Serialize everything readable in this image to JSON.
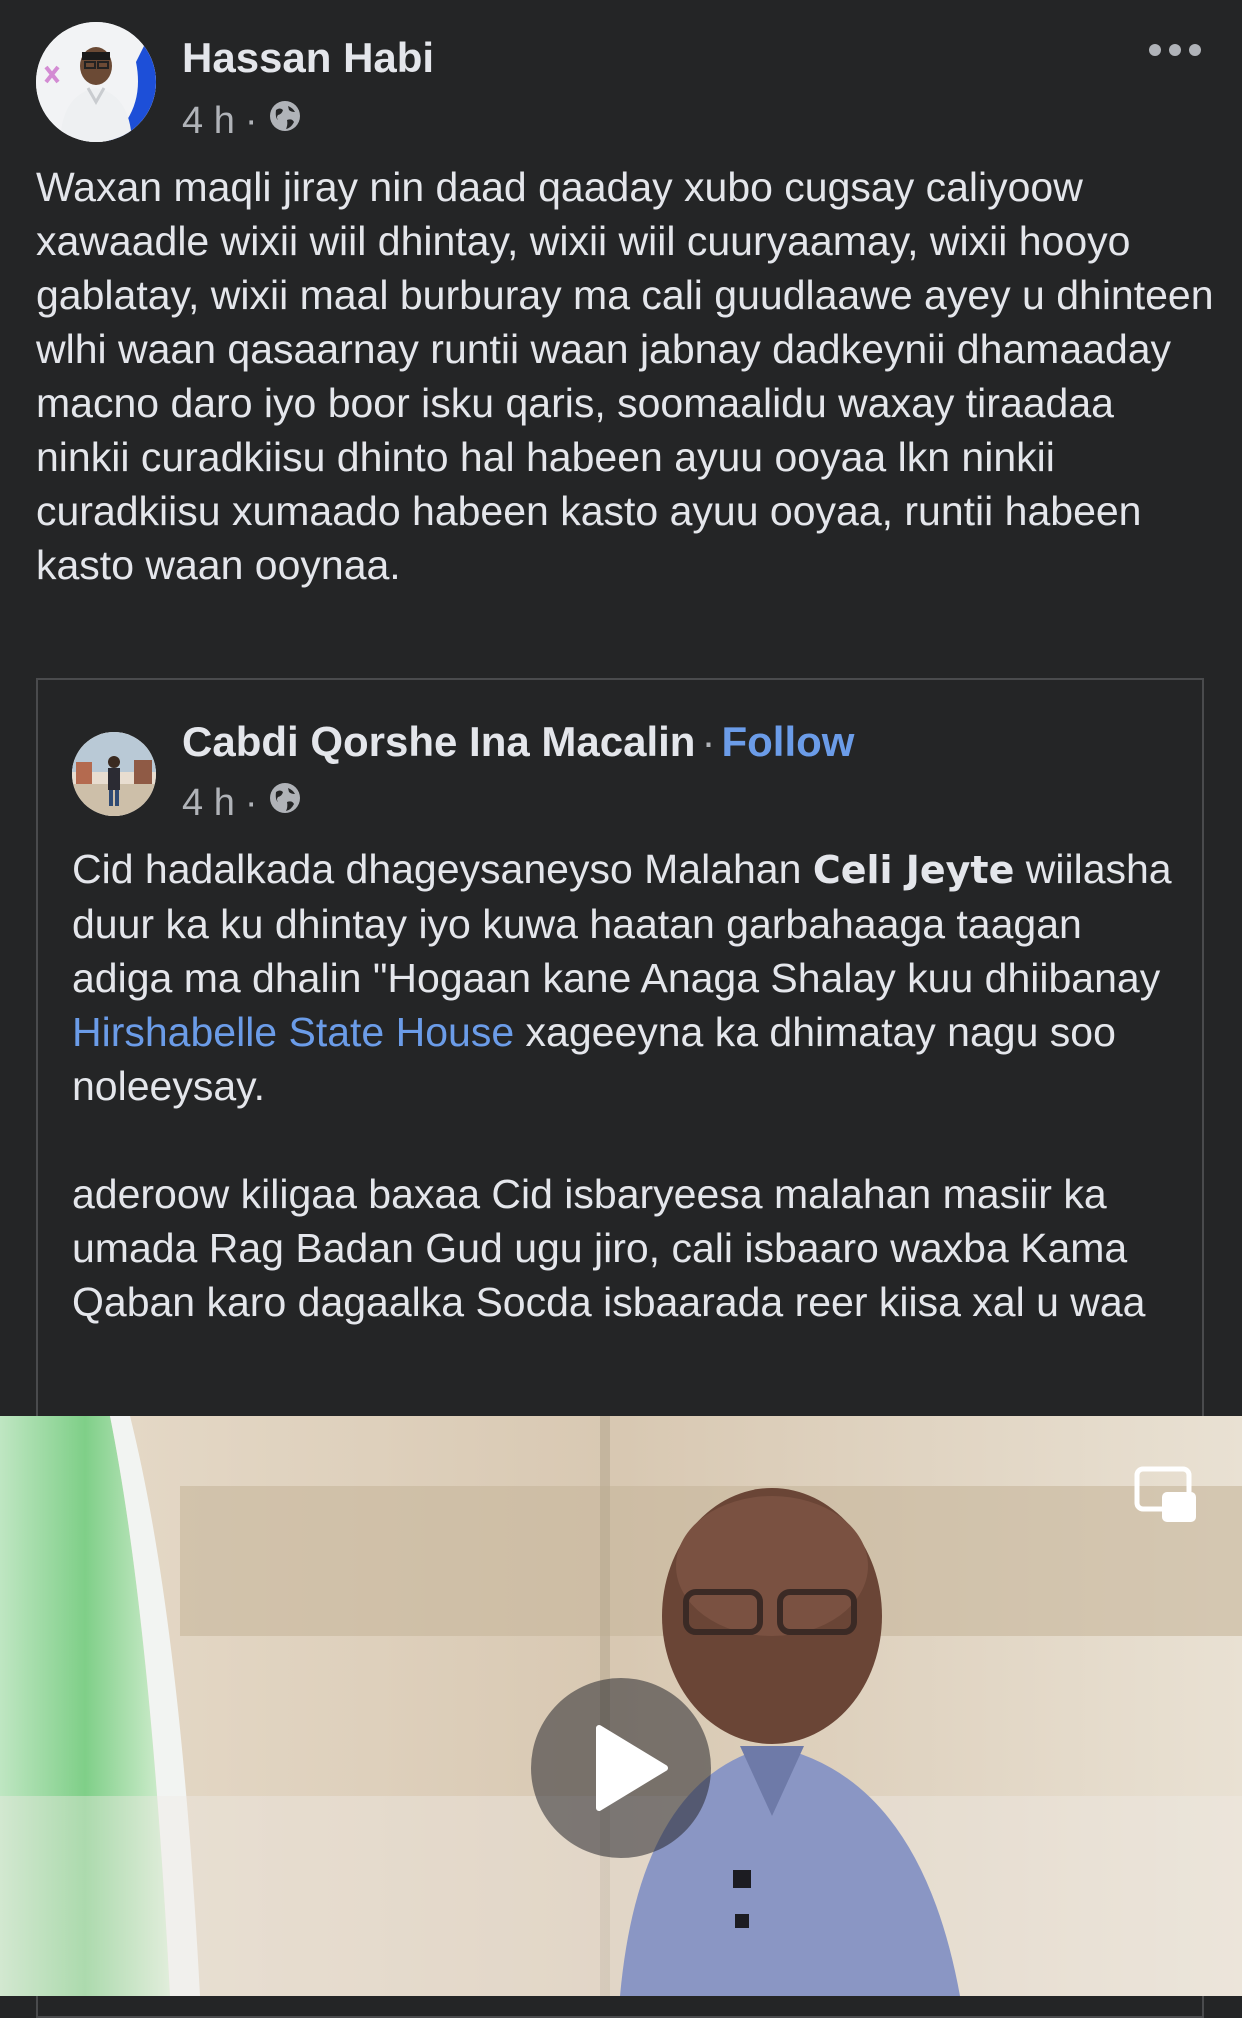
{
  "post": {
    "author": "Hassan Habi",
    "time": "4 h",
    "separator": "·",
    "audience_icon": "globe-icon",
    "more_icon": "more-horizontal-icon",
    "text": "Waxan maqli jiray nin daad qaaday xubo cugsay caliyoow xawaadle wixii wiil dhintay, wixii wiil cuuryaamay, wixii hooyo gablatay, wixii maal burburay ma cali guudlaawe ayey u dhinteen wlhi waan qasaarnay runtii waan jabnay dadkeynii dhamaaday macno daro iyo boor isku qaris, soomaalidu waxay tiraadaa ninkii curadkiisu dhinto hal habeen ayuu ooyaa lkn ninkii curadkiisu xumaado habeen kasto ayuu ooyaa, runtii habeen kasto waan ooynaa."
  },
  "shared_post": {
    "author": "Cabdi Qorshe Ina Macalin",
    "separator": "·",
    "follow_label": "Follow",
    "time": "4 h",
    "audience_icon": "globe-icon",
    "text_part1": "Cid hadalkada dhageysaneyso Malahan ",
    "mention": "Celi Jeyte",
    "text_part2": " wiilasha duur ka ku dhintay iyo kuwa haatan garbahaaga taagan adiga ma dhalin \"Hogaan kane Anaga Shalay kuu dhiibanay  ",
    "page_link": "Hirshabelle State House",
    "text_part3": " xageeyna ka dhimatay nagu soo noleeysay.",
    "text_para2": "aderoow kiligaa baxaa Cid isbaryeesa malahan masiir ka umada Rag Badan Gud ugu jiro, cali isbaaro waxba Kama Qaban karo dagaalka Socda isbaarada reer kiisa xal u waa"
  },
  "video": {
    "play_icon": "play-icon",
    "pip_icon": "picture-in-picture-icon"
  },
  "colors": {
    "background": "#242526",
    "text": "#e4e6eb",
    "secondary_text": "#b0b3b8",
    "link": "#6b9ce8",
    "border": "#4a4b4d"
  }
}
